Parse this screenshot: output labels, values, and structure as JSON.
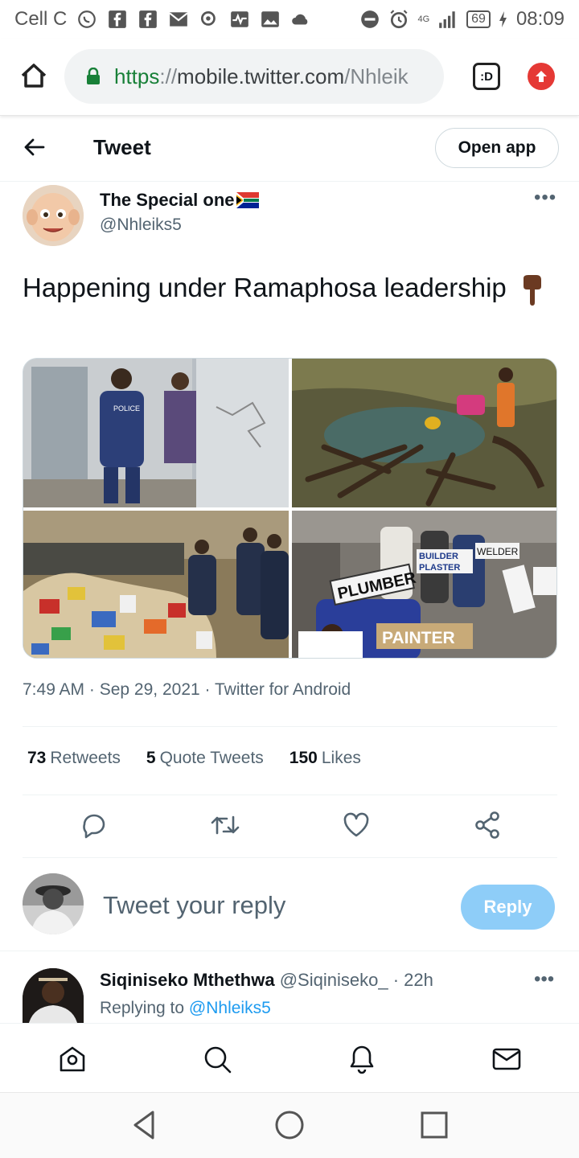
{
  "status_bar": {
    "carrier": "Cell C",
    "network": "4G",
    "battery": "69",
    "time": "08:09"
  },
  "browser": {
    "url_scheme": "https",
    "url_separator": "://",
    "url_host": "mobile.twitter.com",
    "url_path": "/Nhleik",
    "tabs_label": ":D"
  },
  "header": {
    "title": "Tweet",
    "open_app_label": "Open app"
  },
  "tweet": {
    "author_name": "The Special one",
    "author_handle": "@Nhleiks5",
    "more": "•••",
    "text": "Happening under Ramaphosa leadership",
    "time": "7:49 AM",
    "date": "Sep 29, 2021",
    "source": "Twitter for Android",
    "meta_separator": " · ",
    "retweets_count": "73",
    "retweets_label": "Retweets",
    "quotes_count": "5",
    "quotes_label": "Quote Tweets",
    "likes_count": "150",
    "likes_label": "Likes",
    "image_signs": {
      "police": "POLICE",
      "plumber": "PLUMBER",
      "painter": "PAINTER",
      "builder": "BUILDER",
      "plaster": "PLASTER",
      "welder": "WELDER"
    }
  },
  "composer": {
    "placeholder": "Tweet your reply",
    "reply_label": "Reply"
  },
  "next_tweet": {
    "author_name": "Siqiniseko Mthethwa",
    "author_handle": "@Siqiniseko_",
    "age": "22h",
    "more": "•••",
    "replying_to_label": "Replying to",
    "replying_to_handle": "@Nhleiks5"
  },
  "colors": {
    "accent": "#1d9bf0",
    "reply_button": "#8ecdf8",
    "secure_green": "#188038",
    "update_red": "#e53935"
  }
}
